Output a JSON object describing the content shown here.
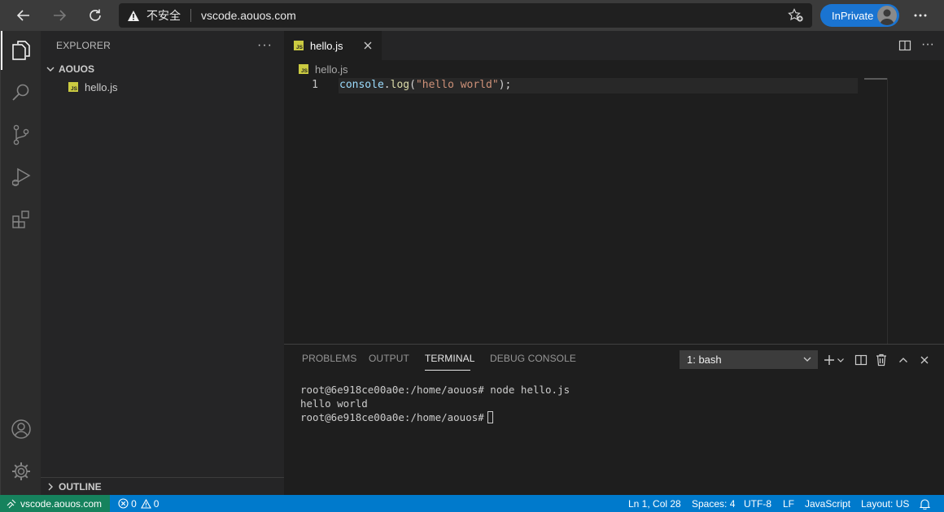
{
  "browser": {
    "security_label": "不安全",
    "url": "vscode.aouos.com",
    "inprivate_label": "InPrivate"
  },
  "sidebar": {
    "title": "EXPLORER",
    "folder_name": "AOUOS",
    "files": [
      {
        "name": "hello.js",
        "icon": "js-file-icon"
      }
    ],
    "outline_label": "OUTLINE"
  },
  "editor": {
    "tab_label": "hello.js",
    "breadcrumb_file": "hello.js",
    "line_number": "1",
    "code": {
      "object": "console",
      "dot": ".",
      "method": "log",
      "open_paren": "(",
      "string": "\"hello world\"",
      "close": ");"
    }
  },
  "panel": {
    "tabs": [
      "PROBLEMS",
      "OUTPUT",
      "TERMINAL",
      "DEBUG CONSOLE"
    ],
    "active_tab": "TERMINAL",
    "terminal_select": "1: bash",
    "terminal_lines": [
      "root@6e918ce00a0e:/home/aouos# node hello.js",
      "hello world",
      "root@6e918ce00a0e:/home/aouos#"
    ]
  },
  "status": {
    "remote": "vscode.aouos.com",
    "errors": "0",
    "warnings": "0",
    "position": "Ln 1, Col 28",
    "spaces": "Spaces: 4",
    "encoding": "UTF-8",
    "eol": "LF",
    "language": "JavaScript",
    "layout": "Layout: US"
  },
  "colors": {
    "accent": "#007acc",
    "remote": "#16825d",
    "inprivate": "#1a74d1",
    "js_badge": "#cbcb41"
  }
}
